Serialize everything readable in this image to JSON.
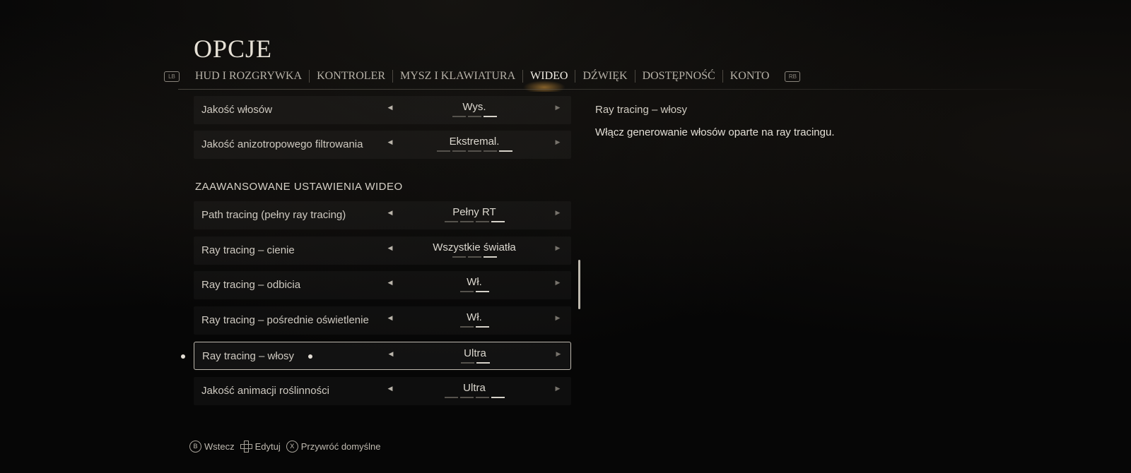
{
  "header": {
    "title": "OPCJE"
  },
  "tabs": {
    "left_bumper": "LB",
    "right_bumper": "RB",
    "items": [
      {
        "label": "HUD I ROZGRYWKA"
      },
      {
        "label": "KONTROLER"
      },
      {
        "label": "MYSZ I KLAWIATURA"
      },
      {
        "label": "WIDEO",
        "active": true
      },
      {
        "label": "DŹWIĘK"
      },
      {
        "label": "DOSTĘPNOŚĆ"
      },
      {
        "label": "KONTO"
      }
    ]
  },
  "settings": {
    "section_title": "ZAAWANSOWANE USTAWIENIA WIDEO",
    "arrow_left": "◀",
    "arrow_right": "▶",
    "rows": [
      {
        "label": "Jakość włosów",
        "value": "Wys.",
        "level": 3,
        "levels": 3
      },
      {
        "label": "Jakość anizotropowego filtrowania",
        "value": "Ekstremal.",
        "level": 5,
        "levels": 5
      },
      {
        "label": "Path tracing (pełny ray tracing)",
        "value": "Pełny RT",
        "level": 4,
        "levels": 4
      },
      {
        "label": "Ray tracing – cienie",
        "value": "Wszystkie światła",
        "level": 3,
        "levels": 3
      },
      {
        "label": "Ray tracing – odbicia",
        "value": "Wł.",
        "level": 2,
        "levels": 2
      },
      {
        "label": "Ray tracing – pośrednie oświetlenie",
        "value": "Wł.",
        "level": 2,
        "levels": 2
      },
      {
        "label": "Ray tracing – włosy",
        "value": "Ultra",
        "level": 2,
        "levels": 2,
        "selected": true
      },
      {
        "label": "Jakość animacji roślinności",
        "value": "Ultra",
        "level": 4,
        "levels": 4
      }
    ]
  },
  "description": {
    "title": "Ray tracing – włosy",
    "text": "Włącz generowanie włosów oparte na ray tracingu."
  },
  "footer": {
    "back_key": "B",
    "back_label": "Wstecz",
    "edit_label": "Edytuj",
    "reset_key": "X",
    "reset_label": "Przywróć domyślne"
  }
}
